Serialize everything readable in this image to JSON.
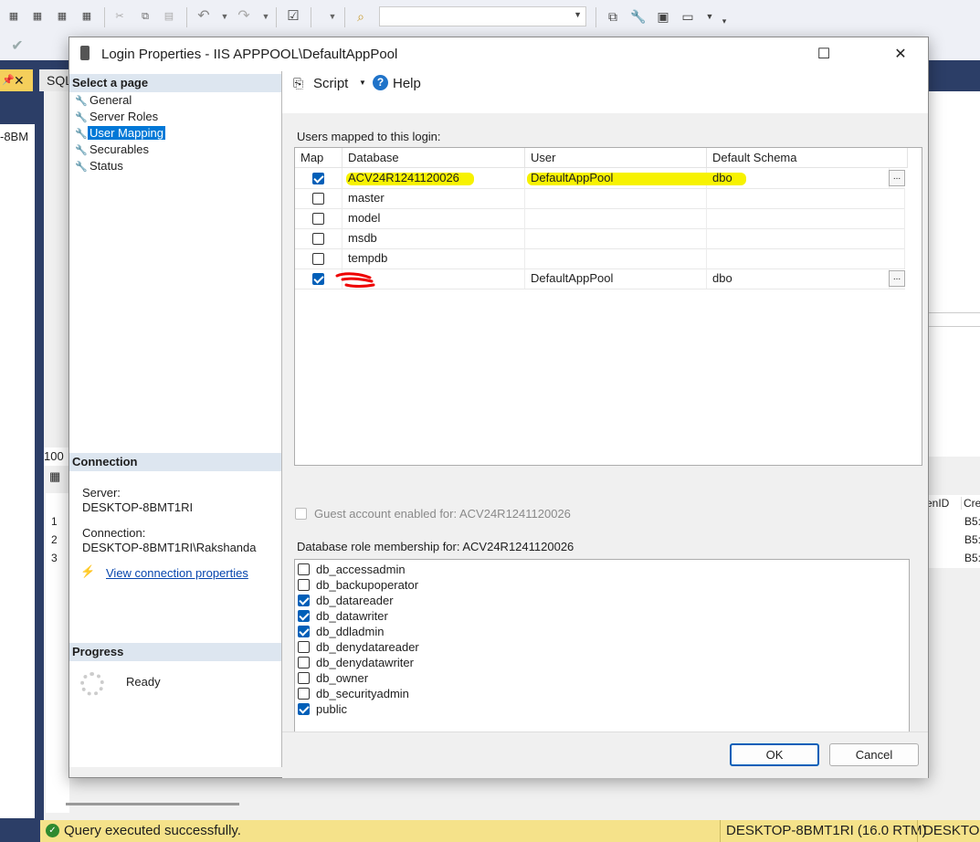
{
  "background": {
    "tab_sql": "SQL",
    "left_snip": "-8BM",
    "lower_left_rows": [
      "1",
      "2",
      "3"
    ],
    "zoom_fragment": "100",
    "result_headers": [
      "enID",
      "Cre"
    ],
    "result_cells": [
      "B5:",
      "B5:",
      "B5:"
    ],
    "status_message": "Query executed successfully.",
    "status_server": "DESKTOP-8BMT1RI (16.0 RTM)",
    "status_server2": "DESKTOP",
    "toolbar_icons": [
      "mdx-icon",
      "dmx-icon",
      "xmla-icon",
      "dax-icon"
    ]
  },
  "dialog": {
    "title": "Login Properties - IIS APPPOOL\\DefaultAppPool",
    "select_page_header": "Select a page",
    "pages": [
      {
        "label": "General",
        "selected": false
      },
      {
        "label": "Server Roles",
        "selected": false
      },
      {
        "label": "User Mapping",
        "selected": true
      },
      {
        "label": "Securables",
        "selected": false
      },
      {
        "label": "Status",
        "selected": false
      }
    ],
    "connection": {
      "header": "Connection",
      "server_label": "Server:",
      "server_value": "DESKTOP-8BMT1RI",
      "connection_label": "Connection:",
      "connection_value": "DESKTOP-8BMT1RI\\Rakshanda",
      "view_link": "View connection properties"
    },
    "progress": {
      "header": "Progress",
      "status": "Ready"
    },
    "toolbar": {
      "script_label": "Script",
      "help_label": "Help"
    },
    "users_mapped_label": "Users mapped to this login:",
    "grid": {
      "columns": [
        "Map",
        "Database",
        "User",
        "Default Schema"
      ],
      "rows": [
        {
          "map": true,
          "database": "ACV24R1241120026",
          "user": "DefaultAppPool",
          "schema": "dbo",
          "has_ellipsis": true,
          "highlighted": true
        },
        {
          "map": false,
          "database": "master",
          "user": "",
          "schema": "",
          "has_ellipsis": false,
          "highlighted": false
        },
        {
          "map": false,
          "database": "model",
          "user": "",
          "schema": "",
          "has_ellipsis": false,
          "highlighted": false
        },
        {
          "map": false,
          "database": "msdb",
          "user": "",
          "schema": "",
          "has_ellipsis": false,
          "highlighted": false
        },
        {
          "map": false,
          "database": "tempdb",
          "user": "",
          "schema": "",
          "has_ellipsis": false,
          "highlighted": false
        },
        {
          "map": true,
          "database": "",
          "user": "DefaultAppPool",
          "schema": "dbo",
          "has_ellipsis": true,
          "highlighted": false,
          "redacted": true
        }
      ],
      "ellipsis": "..."
    },
    "guest_label": "Guest account enabled for: ACV24R1241120026",
    "role_membership_label": "Database role membership for: ACV24R1241120026",
    "roles": [
      {
        "label": "db_accessadmin",
        "checked": false
      },
      {
        "label": "db_backupoperator",
        "checked": false
      },
      {
        "label": "db_datareader",
        "checked": true
      },
      {
        "label": "db_datawriter",
        "checked": true
      },
      {
        "label": "db_ddladmin",
        "checked": true
      },
      {
        "label": "db_denydatareader",
        "checked": false
      },
      {
        "label": "db_denydatawriter",
        "checked": false
      },
      {
        "label": "db_owner",
        "checked": false
      },
      {
        "label": "db_securityadmin",
        "checked": false
      },
      {
        "label": "public",
        "checked": true
      }
    ],
    "ok_label": "OK",
    "cancel_label": "Cancel"
  }
}
